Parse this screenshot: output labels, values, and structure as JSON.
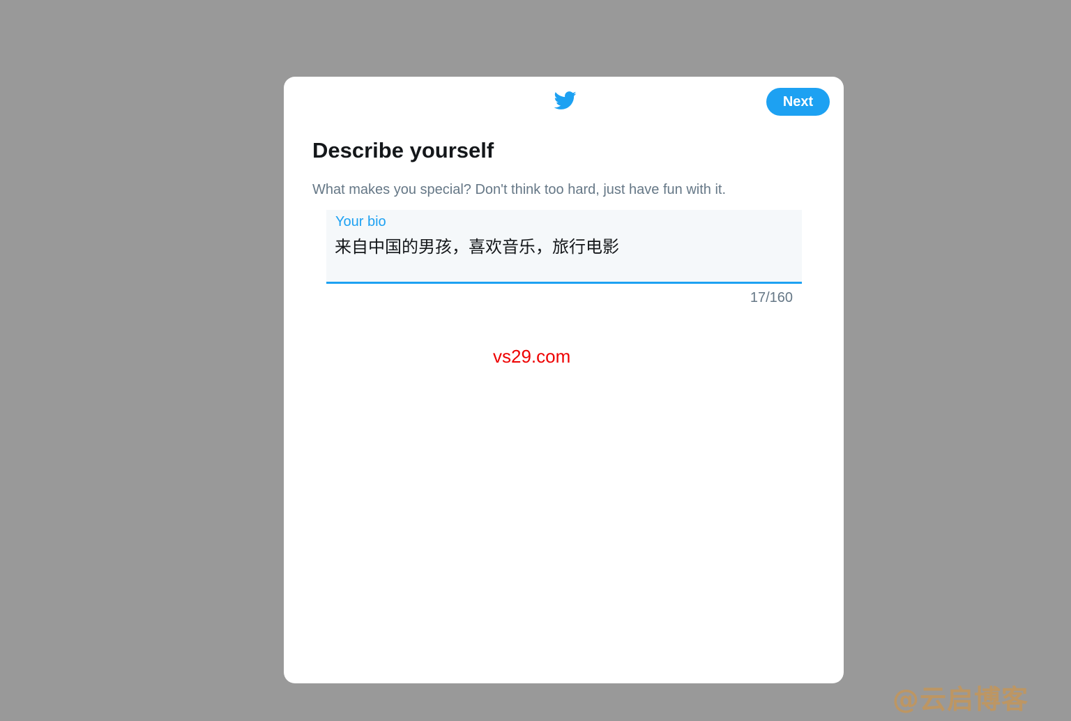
{
  "modal": {
    "logo_icon": "twitter-bird-icon",
    "next_label": "Next",
    "title": "Describe yourself",
    "subtitle": "What makes you special? Don't think too hard, just have fun with it.",
    "bio": {
      "label": "Your bio",
      "value": "来自中国的男孩，喜欢音乐，旅行电影",
      "counter": "17/160"
    }
  },
  "watermarks": {
    "site": "vs29.com",
    "blog": "@云启博客"
  },
  "colors": {
    "accent": "#1da1f2",
    "backdrop": "#999999",
    "title": "#14171a",
    "secondary_text": "#657786",
    "field_bg": "#f5f8fa",
    "watermark_site": "#ee0000",
    "watermark_blog": "#c4965a"
  }
}
